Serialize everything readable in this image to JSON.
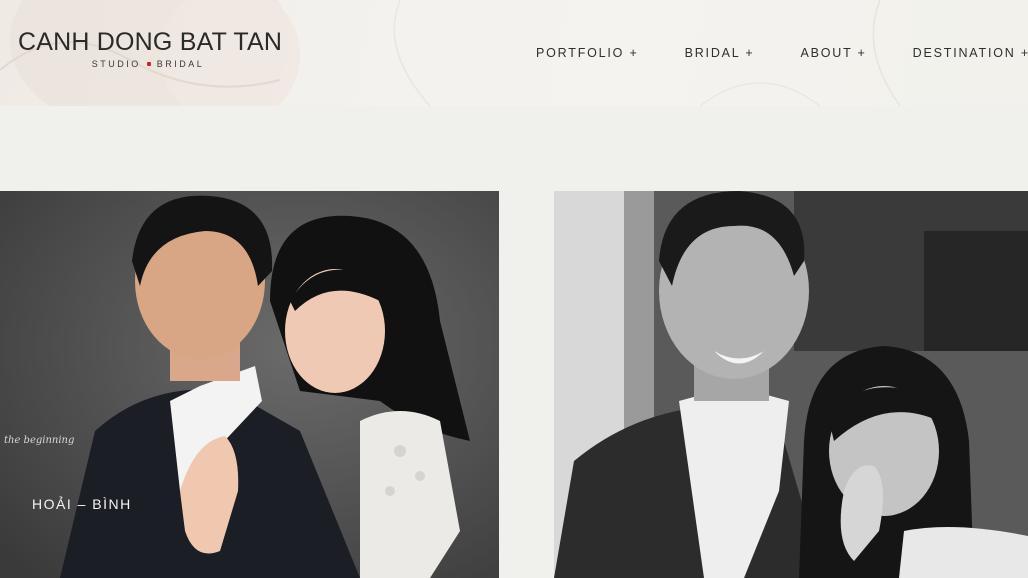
{
  "logo": {
    "title": "CANH DONG BAT TAN",
    "subtitle_left": "STUDIO",
    "subtitle_right": "BRIDAL",
    "accent_color": "#d2222d"
  },
  "nav": {
    "items": [
      {
        "label": "PORTFOLIO +"
      },
      {
        "label": "BRIDAL +"
      },
      {
        "label": "ABOUT +"
      },
      {
        "label": "DESTINATION +"
      }
    ]
  },
  "gallery": {
    "items": [
      {
        "caption": "HOẢI – BÌNH",
        "script_text": "the beginning"
      },
      {
        "caption": ""
      }
    ]
  }
}
